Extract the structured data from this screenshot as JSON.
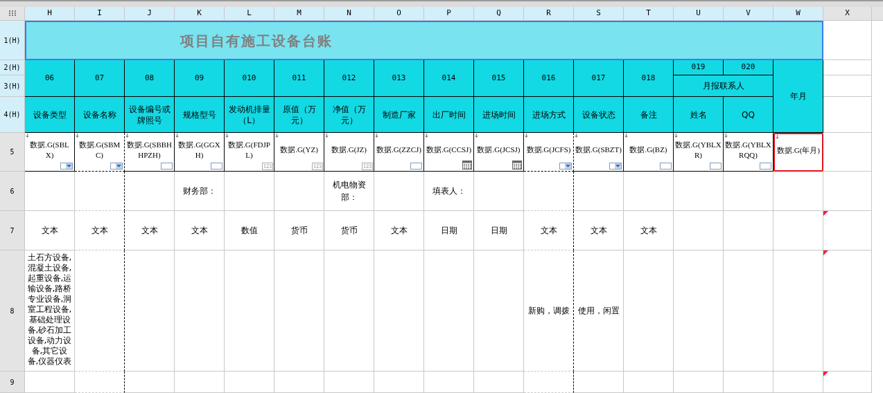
{
  "row_headers": [
    {
      "label": "1(H)",
      "comment": false
    },
    {
      "label": "2(H)",
      "comment": false
    },
    {
      "label": "3(H)",
      "comment": false
    },
    {
      "label": "4(H)",
      "comment": false
    },
    {
      "label": "5",
      "comment": false
    },
    {
      "label": "6",
      "comment": false
    },
    {
      "label": "7",
      "comment": true
    },
    {
      "label": "8",
      "comment": true
    },
    {
      "label": "9",
      "comment": true
    }
  ],
  "title": {
    "text": "项目自有施工设备台账",
    "selected": true
  },
  "contact_group": "月报联系人",
  "columns": [
    {
      "letter": "H",
      "code": "06",
      "in_group": false,
      "field": "设备类型",
      "binding": {
        "text": "数据.G(SBLX)",
        "kind": "dropdown",
        "selected": false
      },
      "type": "文本",
      "note": "土石方设备,混凝土设备,起重设备,运输设备,路桥专业设备,洞室工程设备,基础处理设备,砂石加工设备,动力设备,其它设备,仪器仪表"
    },
    {
      "letter": "I",
      "code": "07",
      "in_group": false,
      "field": "设备名称",
      "binding": {
        "text": "数据.G(SBMC)",
        "kind": "dropdown",
        "selected": false
      },
      "type": "文本"
    },
    {
      "letter": "J",
      "code": "08",
      "in_group": false,
      "field": "设备编号或牌照号",
      "binding": {
        "text": "数据.G(SBBHHPZH)",
        "kind": "text",
        "selected": false
      },
      "type": "文本"
    },
    {
      "letter": "K",
      "code": "09",
      "in_group": false,
      "field": "规格型号",
      "binding": {
        "text": "数据.G(GGXH)",
        "kind": "text",
        "selected": false
      },
      "sign": "财务部：",
      "type": "文本"
    },
    {
      "letter": "L",
      "code": "010",
      "in_group": false,
      "field": "发动机排量（L）",
      "binding": {
        "text": "数据.G(FDJPL)",
        "kind": "number",
        "badge": "123",
        "selected": false
      },
      "type": "数值"
    },
    {
      "letter": "M",
      "code": "011",
      "in_group": false,
      "field": "原值（万元）",
      "binding": {
        "text": "数据.G(YZ)",
        "kind": "number",
        "badge": "123",
        "selected": false
      },
      "type": "货币"
    },
    {
      "letter": "N",
      "code": "012",
      "in_group": false,
      "field": "净值（万元）",
      "binding": {
        "text": "数据.G(JZ)",
        "kind": "number",
        "badge": "123",
        "selected": false
      },
      "sign": "机电物资部：",
      "type": "货币"
    },
    {
      "letter": "O",
      "code": "013",
      "in_group": false,
      "field": "制造厂家",
      "binding": {
        "text": "数据.G(ZZCJ)",
        "kind": "text",
        "selected": false
      },
      "type": "文本"
    },
    {
      "letter": "P",
      "code": "014",
      "in_group": false,
      "field": "出厂时间",
      "binding": {
        "text": "数据.G(CCSJ)",
        "kind": "date",
        "selected": false
      },
      "sign": "填表人：",
      "type": "日期"
    },
    {
      "letter": "Q",
      "code": "015",
      "in_group": false,
      "field": "进场时间",
      "binding": {
        "text": "数据.G(JCSJ)",
        "kind": "date",
        "selected": false
      },
      "type": "日期"
    },
    {
      "letter": "R",
      "code": "016",
      "in_group": false,
      "field": "进场方式",
      "binding": {
        "text": "数据.G(JCFS)",
        "kind": "dropdown",
        "selected": false
      },
      "type": "文本",
      "note": "新购，调拨"
    },
    {
      "letter": "S",
      "code": "017",
      "in_group": false,
      "field": "设备状态",
      "binding": {
        "text": "数据.G(SBZT)",
        "kind": "dropdown",
        "selected": false
      },
      "type": "文本",
      "note": "使用，闲置"
    },
    {
      "letter": "T",
      "code": "018",
      "in_group": false,
      "field": "备注",
      "binding": {
        "text": "数据.G(BZ)",
        "kind": "text",
        "selected": false
      },
      "type": "文本"
    },
    {
      "letter": "U",
      "code": "019",
      "in_group": true,
      "field": "姓名",
      "binding": {
        "text": "数据.G(YBLXR)",
        "kind": "text",
        "selected": false
      }
    },
    {
      "letter": "V",
      "code": "020",
      "in_group": true,
      "field": "QQ",
      "binding": {
        "text": "数据.G(YBLXRQQ)",
        "kind": "text",
        "selected": false
      }
    },
    {
      "letter": "W",
      "field": "年月",
      "binding": {
        "text": "数据.G(年月)",
        "kind": "plain",
        "selected": true
      }
    },
    {
      "letter": "X"
    }
  ]
}
